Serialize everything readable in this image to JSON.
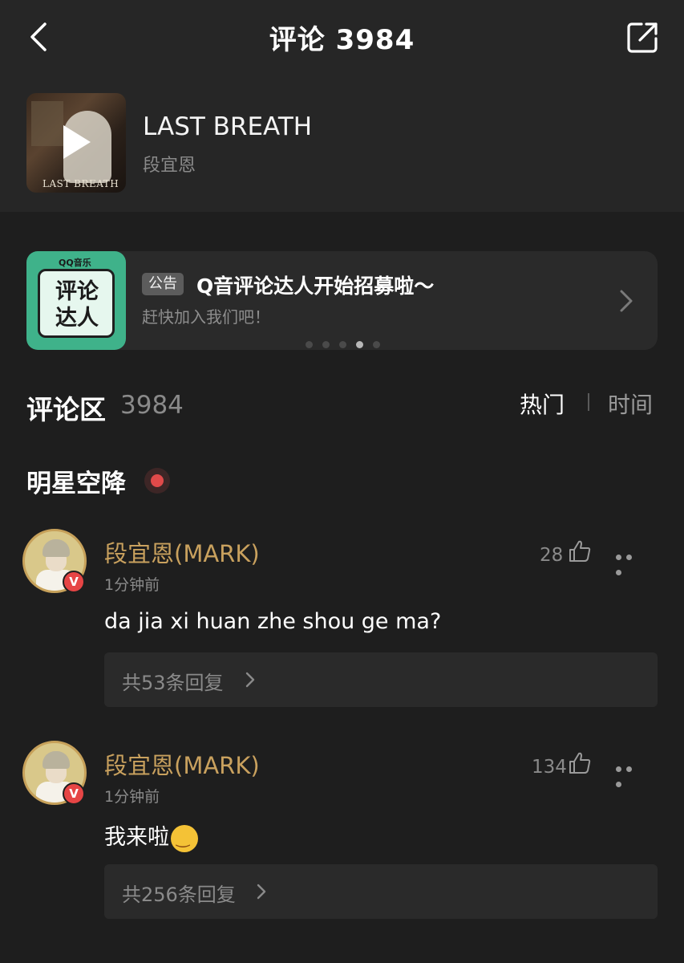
{
  "navbar": {
    "title": "评论 3984",
    "back_icon": "chevron-left-icon",
    "share_icon": "share-external-icon"
  },
  "song": {
    "title": "LAST BREATH",
    "artist": "段宜恩",
    "cover_caption": "LAST BREATH",
    "play_icon": "play-icon"
  },
  "notice": {
    "tag": "公告",
    "title": "Q音评论达人开始招募啦～",
    "subtitle": "赶快加入我们吧！",
    "image_brand": "QQ音乐",
    "image_text": "评论达人",
    "carousel_count": 5,
    "carousel_active": 4
  },
  "section": {
    "label": "评论区",
    "count": "3984",
    "sort_hot": "热门",
    "sort_time": "时间"
  },
  "star_section": {
    "heading": "明星空降"
  },
  "comments": [
    {
      "username": "段宜恩(MARK)",
      "time": "1分钟前",
      "likes": "28",
      "text": "da jia xi huan zhe shou ge ma?",
      "reply_label": "共53条回复",
      "badge": "V"
    },
    {
      "username": "段宜恩(MARK)",
      "time": "1分钟前",
      "likes": "134",
      "text": "我来啦",
      "emoji": "smiling-face-emoji",
      "reply_label": "共256条回复",
      "badge": "V"
    }
  ],
  "colors": {
    "background": "#1e1e1e",
    "panel": "#262626",
    "card": "#2a2a2a",
    "username_gold": "#c9a15e",
    "verified_red": "#e64545",
    "muted_text": "#8a8a8a"
  }
}
